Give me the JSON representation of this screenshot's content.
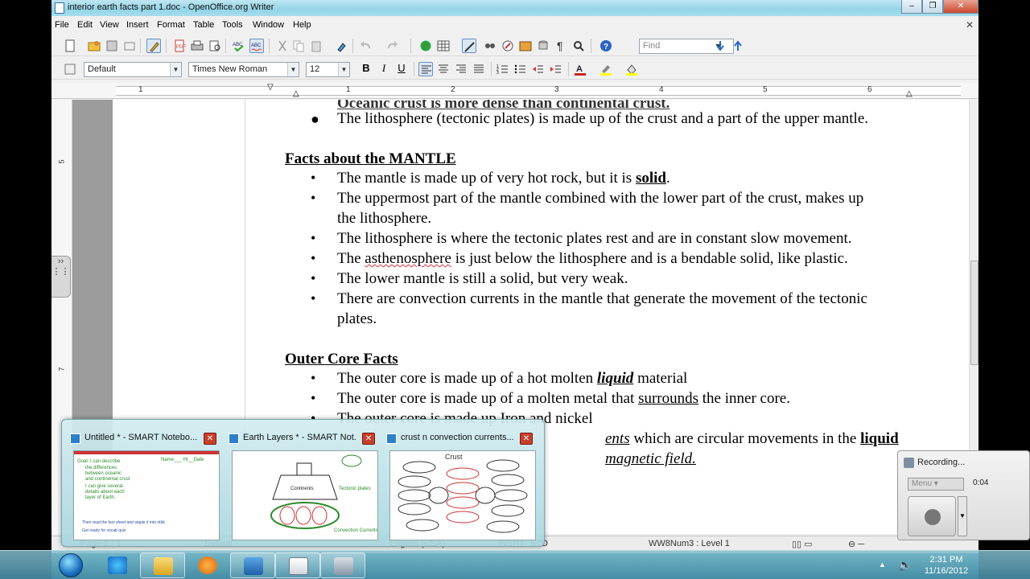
{
  "window": {
    "title": "interior earth facts part 1.doc - OpenOffice.org Writer"
  },
  "menu": [
    "File",
    "Edit",
    "View",
    "Insert",
    "Format",
    "Table",
    "Tools",
    "Window",
    "Help"
  ],
  "toolbar": {
    "find_placeholder": "Find"
  },
  "format_bar": {
    "style": "Default",
    "font": "Times New Roman",
    "size": "12"
  },
  "ruler": {
    "numbers": [
      "1",
      "1",
      "2",
      "3",
      "4",
      "5",
      "6"
    ]
  },
  "document": {
    "top_cut_text": "Oceanic crust is more dense than continental crust.",
    "top_bullet": "The lithosphere (tectonic plates) is made up of the crust and a part of the upper mantle.",
    "mantle_heading": "Facts about the MANTLE",
    "mantle": [
      {
        "pre": "The mantle is made up of very hot rock, but it is ",
        "bold": "solid",
        "post": "."
      },
      {
        "line1": "The uppermost part of the mantle combined with the lower part of the crust, makes up",
        "line2": "the lithosphere."
      },
      {
        "text": "The lithosphere is where the tectonic plates rest and are in constant slow movement."
      },
      {
        "pre": "The ",
        "wavy": "asthenosphere",
        "post": " is just below the lithosphere and is a bendable solid, like plastic."
      },
      {
        "text": "The lower mantle is still a solid, but very weak."
      },
      {
        "line1": "There are convection currents in the mantle that generate the movement of the tectonic",
        "line2": "plates."
      }
    ],
    "outer_heading": "Outer Core Facts",
    "outer": [
      {
        "pre": "The outer core is made up of a hot molten ",
        "bolditalic": "liquid",
        "post": " material"
      },
      {
        "pre": "The outer core is made up of a molten metal that ",
        "underline": "surrounds",
        "post": " the inner core."
      },
      {
        "text": "The outer core is  made up Iron and nickel"
      },
      {
        "italic_u": "ents",
        "mid": " which are circular movements in the ",
        "bold_u": "liquid"
      },
      {
        "italic_u": "magnetic field."
      }
    ]
  },
  "status": {
    "page": "Page 1 / 1",
    "style": "Default",
    "lang": "English (USA)",
    "mode": "INSRT",
    "std": "STD",
    "numbering": "WW8Num3 : Level 1"
  },
  "thumbnails": [
    {
      "title": "Untitled * - SMART Notebo..."
    },
    {
      "title": "Earth Layers * - SMART Not..."
    },
    {
      "title": "crust n convection currents..."
    }
  ],
  "thumb_content": {
    "goal_lines": [
      "Goal: I can describe",
      "the differences",
      "between oceanic",
      "and continental crust",
      "I can give several",
      "details about each",
      "layer of Earth."
    ],
    "name_date": "Name___ Hr__Date",
    "bottom_lines": [
      "Then read the fact sheet and staple it into ntbk",
      "Get ready for vocab quiz"
    ],
    "earth_labels": [
      "Continents",
      "Tectonic plates",
      "Convection Currents"
    ],
    "crust_label": "Crust"
  },
  "recorder": {
    "title": "Recording...",
    "menu": "Menu",
    "time": "0:04"
  },
  "clock": {
    "time": "2:31 PM",
    "date": "11/16/2012"
  }
}
